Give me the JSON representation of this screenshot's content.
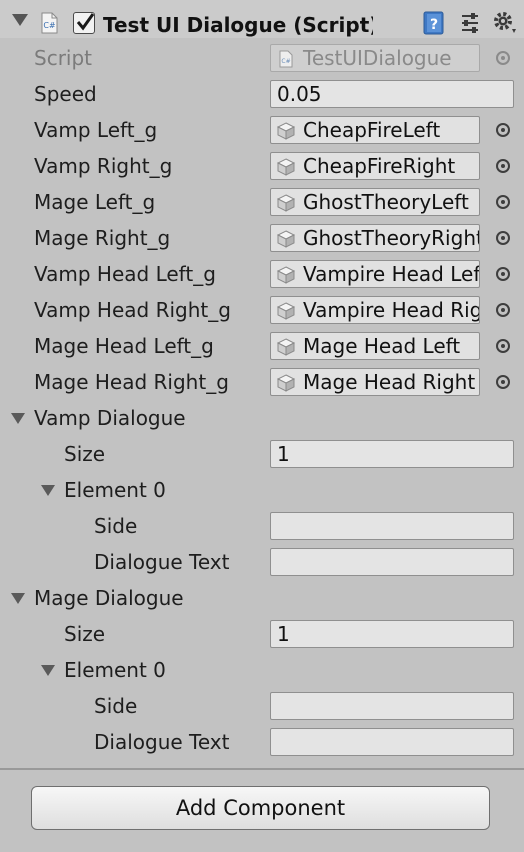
{
  "component": {
    "title": "Test UI Dialogue (Script)",
    "enabled": true,
    "script_icon_text": "C#",
    "help_icon_text": "?"
  },
  "fields": {
    "script": {
      "label": "Script",
      "value": "TestUIDialogue"
    },
    "speed": {
      "label": "Speed",
      "value": "0.05"
    },
    "objects": [
      {
        "label": "Vamp Left_g",
        "value": "CheapFireLeft"
      },
      {
        "label": "Vamp Right_g",
        "value": "CheapFireRight"
      },
      {
        "label": "Mage Left_g",
        "value": "GhostTheoryLeft"
      },
      {
        "label": "Mage Right_g",
        "value": "GhostTheoryRight"
      },
      {
        "label": "Vamp Head Left_g",
        "value": "Vampire Head Left"
      },
      {
        "label": "Vamp Head Right_g",
        "value": "Vampire Head Right"
      },
      {
        "label": "Mage Head Left_g",
        "value": "Mage Head Left"
      },
      {
        "label": "Mage Head Right_g",
        "value": "Mage Head Right"
      }
    ]
  },
  "vamp_dialogue": {
    "label": "Vamp Dialogue",
    "size_label": "Size",
    "size_value": "1",
    "element_label": "Element 0",
    "side_label": "Side",
    "side_value": "",
    "text_label": "Dialogue Text",
    "text_value": ""
  },
  "mage_dialogue": {
    "label": "Mage Dialogue",
    "size_label": "Size",
    "size_value": "1",
    "element_label": "Element 0",
    "side_label": "Side",
    "side_value": "",
    "text_label": "Dialogue Text",
    "text_value": ""
  },
  "add_component_label": "Add Component"
}
